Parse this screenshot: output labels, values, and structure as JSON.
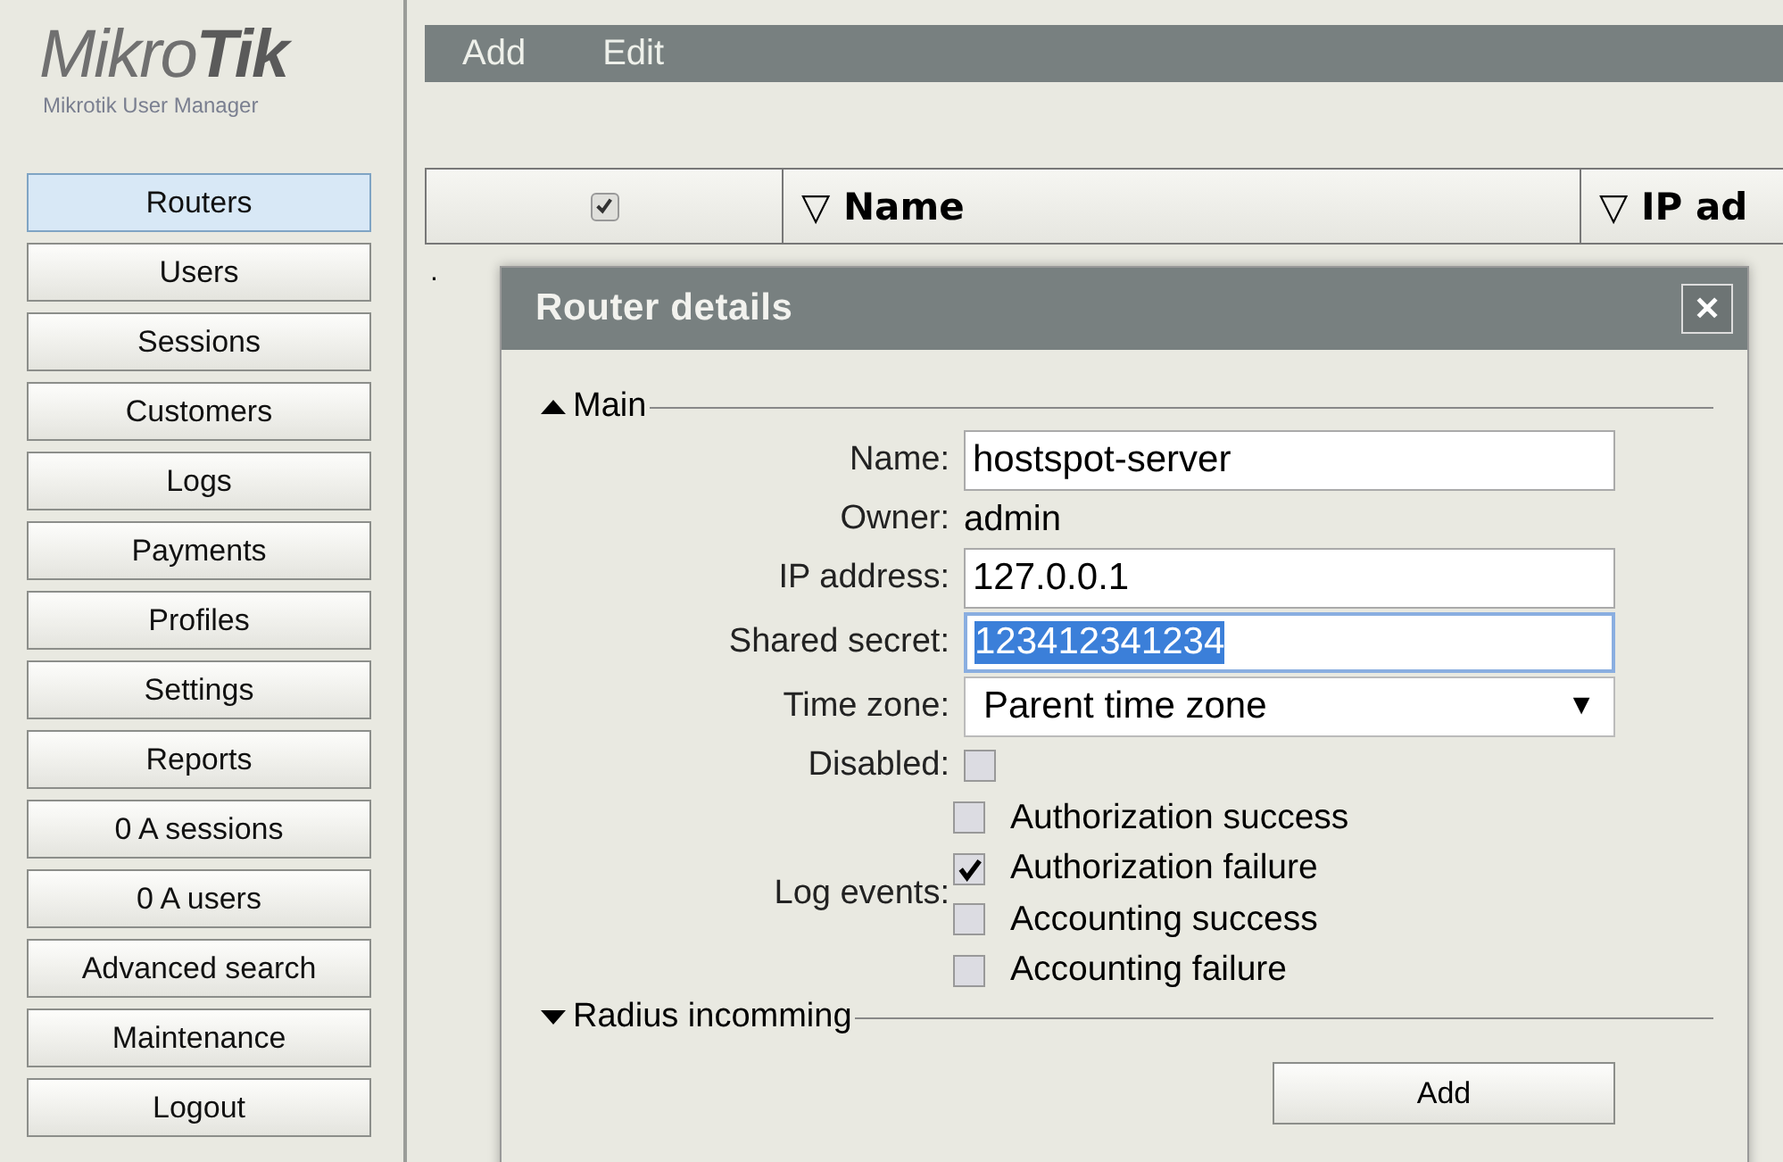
{
  "logo": {
    "brand_light": "Mikro",
    "brand_bold": "Tik",
    "subtitle": "Mikrotik User Manager"
  },
  "sidebar": {
    "items": [
      {
        "label": "Routers",
        "selected": true
      },
      {
        "label": "Users",
        "selected": false
      },
      {
        "label": "Sessions",
        "selected": false
      },
      {
        "label": "Customers",
        "selected": false
      },
      {
        "label": "Logs",
        "selected": false
      },
      {
        "label": "Payments",
        "selected": false
      },
      {
        "label": "Profiles",
        "selected": false
      },
      {
        "label": "Settings",
        "selected": false
      },
      {
        "label": "Reports",
        "selected": false
      },
      {
        "label": "0 A sessions",
        "selected": false
      },
      {
        "label": "0 A users",
        "selected": false
      },
      {
        "label": "Advanced search",
        "selected": false
      },
      {
        "label": "Maintenance",
        "selected": false
      },
      {
        "label": "Logout",
        "selected": false
      }
    ]
  },
  "toolbar": [
    "Add",
    "Edit"
  ],
  "table": {
    "select_all_checked": true,
    "columns": [
      {
        "label": "▽ Name"
      },
      {
        "label": "▽ IP ad"
      }
    ],
    "row_marker": "."
  },
  "dialog": {
    "title": "Router details",
    "close": "✕",
    "sections": [
      {
        "title": "Main",
        "expanded": true,
        "fields": [
          {
            "kind": "input",
            "label": "Name:",
            "value": "hostspot-server",
            "focused": false
          },
          {
            "kind": "text",
            "label": "Owner:",
            "value": "admin"
          },
          {
            "kind": "input",
            "label": "IP address:",
            "value": "127.0.0.1",
            "focused": false
          },
          {
            "kind": "input",
            "label": "Shared secret:",
            "value": "123412341234",
            "focused": true
          },
          {
            "kind": "select",
            "label": "Time zone:",
            "value": "Parent time zone",
            "arrow": "▼"
          },
          {
            "kind": "checkbox",
            "label": "Disabled:",
            "checked": false
          },
          {
            "kind": "checklist",
            "label": "Log events:",
            "options": [
              {
                "label": "Authorization success",
                "checked": false
              },
              {
                "label": "Authorization failure",
                "checked": true
              },
              {
                "label": "Accounting success",
                "checked": false
              },
              {
                "label": "Accounting failure",
                "checked": false
              }
            ]
          }
        ]
      },
      {
        "title": "Radius incomming",
        "expanded": false,
        "button": "Add"
      }
    ]
  }
}
